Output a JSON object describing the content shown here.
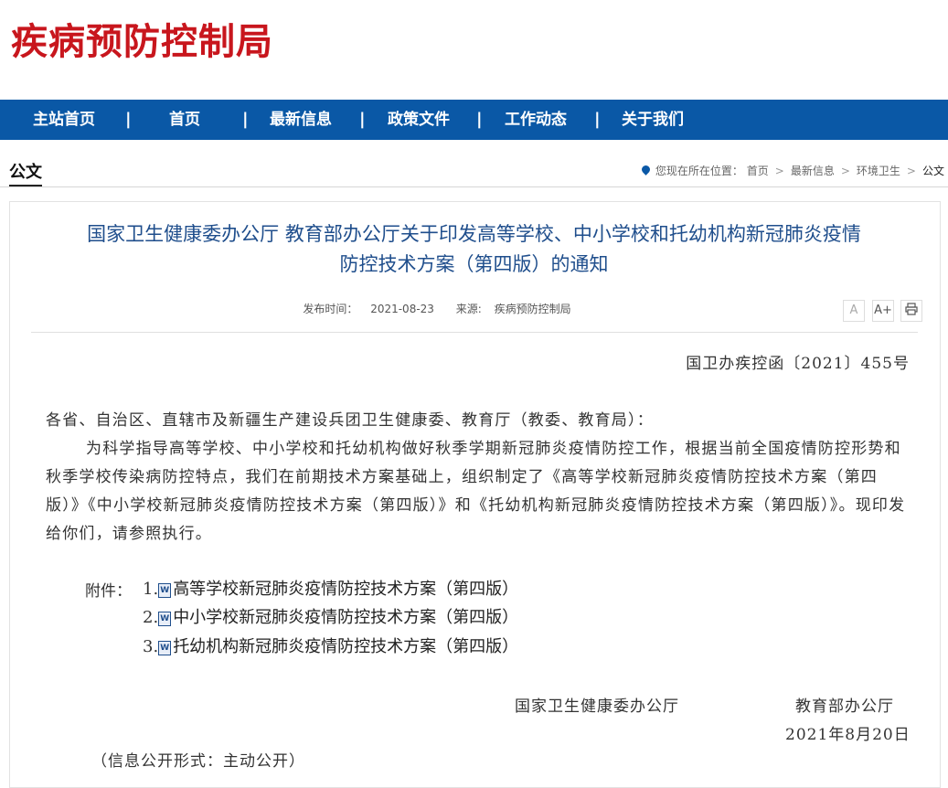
{
  "site": {
    "title": "疾病预防控制局"
  },
  "nav": {
    "items": [
      "主站首页",
      "首页",
      "最新信息",
      "政策文件",
      "工作动态",
      "关于我们"
    ],
    "separator": "|"
  },
  "section": {
    "title": "公文"
  },
  "breadcrumb": {
    "prefix": "您现在所在位置：",
    "items": [
      "首页",
      "最新信息",
      "环境卫生",
      "公文"
    ],
    "separator": ">"
  },
  "article": {
    "title_line1": "国家卫生健康委办公厅 教育部办公厅关于印发高等学校、中小学校和托幼机构新冠肺炎疫情",
    "title_line2": "防控技术方案（第四版）的通知",
    "publish_label": "发布时间：",
    "publish_date": "2021-08-23",
    "source_label": "来源:",
    "source": "疾病预防控制局",
    "tools": {
      "font_smaller": "A",
      "font_larger": "A+",
      "print": "print-icon"
    },
    "doc_number": "国卫办疾控函〔2021〕455号",
    "salutation": "各省、自治区、直辖市及新疆生产建设兵团卫生健康委、教育厅（教委、教育局）：",
    "paragraph": "为科学指导高等学校、中小学校和托幼机构做好秋季学期新冠肺炎疫情防控工作，根据当前全国疫情防控形势和秋季学校传染病防控特点，我们在前期技术方案基础上，组织制定了《高等学校新冠肺炎疫情防控技术方案（第四版）》《中小学校新冠肺炎疫情防控技术方案（第四版）》和《托幼机构新冠肺炎疫情防控技术方案（第四版）》。现印发给你们，请参照执行。",
    "attachments_label": "附件：",
    "attachments": [
      {
        "num": "1.",
        "name": "高等学校新冠肺炎疫情防控技术方案（第四版）"
      },
      {
        "num": "2.",
        "name": "中小学校新冠肺炎疫情防控技术方案（第四版）"
      },
      {
        "num": "3.",
        "name": "托幼机构新冠肺炎疫情防控技术方案（第四版）"
      }
    ],
    "signatory1": "国家卫生健康委办公厅",
    "signatory2": "教育部办公厅",
    "sign_date": "2021年8月20日",
    "info_disclosure": "（信息公开形式：主动公开）"
  },
  "colors": {
    "brand_red": "#c8161d",
    "nav_blue": "#0a58a6",
    "title_blue": "#1f4e8c"
  }
}
